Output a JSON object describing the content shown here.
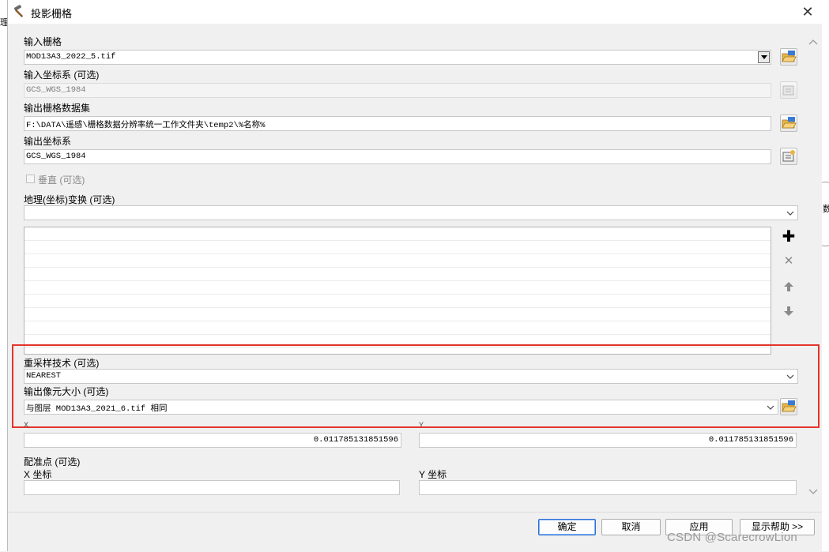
{
  "window": {
    "title": "投影栅格",
    "close_symbol": "✕"
  },
  "background": {
    "left_fragment": "理",
    "right_fragment": "数"
  },
  "fields": {
    "input_raster": {
      "label": "输入栅格",
      "value": "MOD13A3_2022_5.tif"
    },
    "input_coord_system": {
      "label": "输入坐标系 (可选)",
      "value": "GCS_WGS_1984"
    },
    "output_raster_dataset": {
      "label": "输出栅格数据集",
      "value": "F:\\DATA\\遥感\\栅格数据分辨率统一工作文件夹\\temp2\\%名称%"
    },
    "output_coord_system": {
      "label": "输出坐标系",
      "value": "GCS_WGS_1984"
    },
    "vertical": {
      "label": "垂直 (可选)",
      "checked": false
    },
    "geo_transform": {
      "label": "地理(坐标)变换 (可选)",
      "value": ""
    },
    "resampling": {
      "label": "重采样技术 (可选)",
      "value": "NEAREST"
    },
    "output_cell_size": {
      "label": "输出像元大小 (可选)",
      "value": "与图层 MOD13A3_2021_6.tif 相同"
    },
    "cell_x": {
      "label": "X",
      "value": "0.011785131851596"
    },
    "cell_y": {
      "label": "Y",
      "value": "0.011785131851596"
    },
    "registration_point": {
      "label": "配准点 (可选)"
    },
    "reg_x": {
      "label": "X 坐标",
      "value": ""
    },
    "reg_y": {
      "label": "Y 坐标",
      "value": ""
    }
  },
  "list_actions": {
    "add_symbol": "✚",
    "remove_symbol": "✕",
    "up_symbol": "🡅",
    "down_symbol": "🡇"
  },
  "buttons": {
    "ok": "确定",
    "cancel": "取消",
    "apply": "应用",
    "show_help": "显示帮助 >>"
  },
  "watermark": "CSDN @ScarecrowLion",
  "colors": {
    "highlight": "#e4342b",
    "primary_border": "#2d6fd2"
  },
  "icons": [
    "hammer-icon",
    "folder-open-icon",
    "close-icon",
    "plus-icon",
    "remove-icon",
    "arrow-up-icon",
    "arrow-down-icon",
    "chevron-down-icon"
  ]
}
